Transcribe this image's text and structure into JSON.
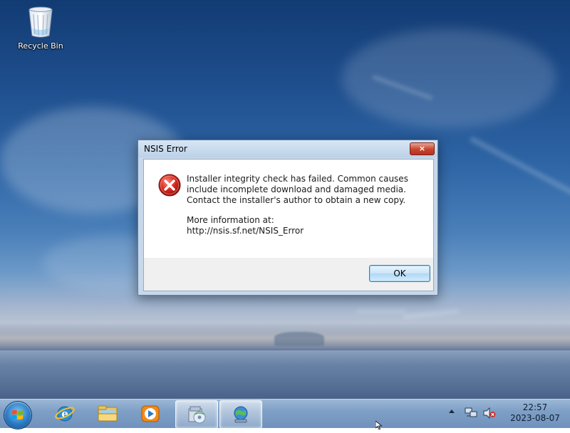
{
  "desktop": {
    "icons": [
      {
        "label": "Recycle Bin",
        "icon": "recycle-bin-icon"
      }
    ]
  },
  "dialog": {
    "title": "NSIS Error",
    "close_label": "×",
    "icon": "error-icon",
    "message_line_1": "Installer integrity check has failed. Common causes include incomplete download and damaged media. Contact the installer's author to obtain a new copy.",
    "message_line_2": "More information at:",
    "message_line_3": "http://nsis.sf.net/NSIS_Error",
    "ok_label": "OK"
  },
  "taskbar": {
    "pinned": [
      {
        "name": "internet-explorer-icon"
      },
      {
        "name": "file-explorer-icon"
      },
      {
        "name": "media-player-icon"
      },
      {
        "name": "installer-app-icon",
        "active": true
      },
      {
        "name": "network-globe-app-icon",
        "active": true
      }
    ],
    "tray": {
      "time": "22:57",
      "date": "2023-08-07"
    }
  },
  "colors": {
    "dialog_frame": "#c8d8ea",
    "close_button": "#c7452f",
    "ok_border": "#3c7fb1",
    "taskbar": "#7f9fc5"
  }
}
